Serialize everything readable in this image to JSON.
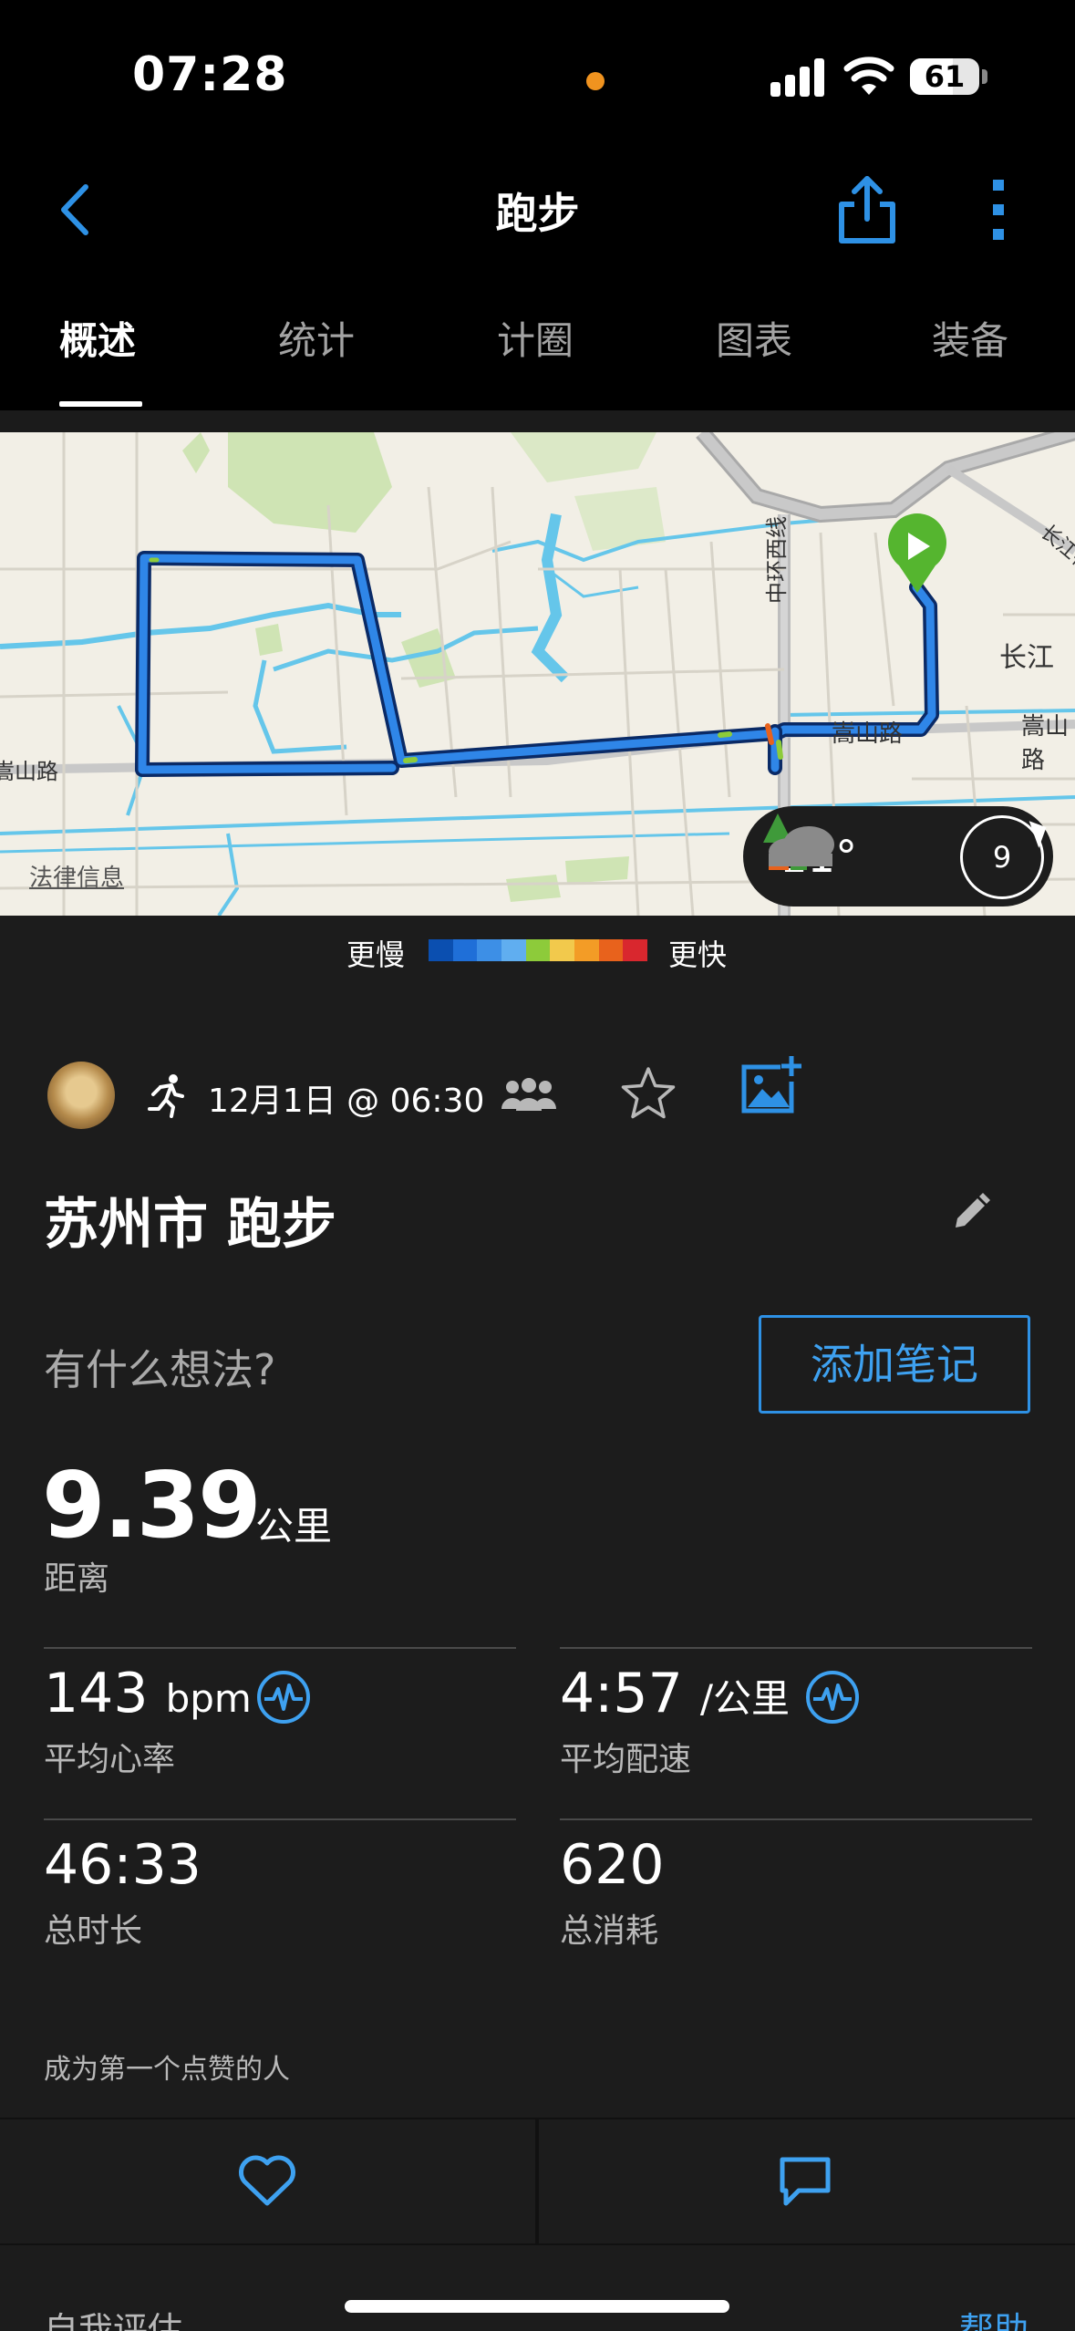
{
  "status_bar": {
    "time": "07:28",
    "battery": "61"
  },
  "nav": {
    "title": "跑步"
  },
  "tabs": [
    {
      "label": "概述",
      "active": true
    },
    {
      "label": "统计",
      "active": false
    },
    {
      "label": "计圈",
      "active": false
    },
    {
      "label": "图表",
      "active": false
    },
    {
      "label": "装备",
      "active": false
    }
  ],
  "map": {
    "road_labels": [
      "中环西线",
      "嵩山路",
      "嵩山路",
      "嵩山路",
      "长江",
      "长江花"
    ],
    "legal_link": "法律信息",
    "weather": {
      "temperature": "11°",
      "wind": "9",
      "icon": "cloud-tree-icon"
    }
  },
  "pace_legend": {
    "slower": "更慢",
    "faster": "更快",
    "colors": [
      "#0b4fb0",
      "#1f6fd8",
      "#3d8fe6",
      "#60aef0",
      "#8dcb3a",
      "#f2c94c",
      "#f39c26",
      "#e8621c",
      "#d9272e"
    ]
  },
  "activity": {
    "date": "12月1日 @ 06:30",
    "title": "苏州市 跑步",
    "notes_prompt": "有什么想法?",
    "add_note": "添加笔记"
  },
  "stats": {
    "distance": {
      "value": "9.39",
      "unit": "公里",
      "label": "距离"
    },
    "avg_hr": {
      "value": "143",
      "unit": "bpm",
      "label": "平均心率"
    },
    "avg_pace": {
      "value": "4:57",
      "unit": "/公里",
      "label": "平均配速"
    },
    "duration": {
      "value": "46:33",
      "label": "总时长"
    },
    "calories": {
      "value": "620",
      "label": "总消耗"
    }
  },
  "social": {
    "likes_hint": "成为第一个点赞的人"
  },
  "footer": {
    "self_eval": "自我评估",
    "help": "帮助"
  },
  "colors": {
    "accent": "#3ea1f0",
    "background": "#1c1c1c",
    "start_marker": "#55b52f"
  }
}
